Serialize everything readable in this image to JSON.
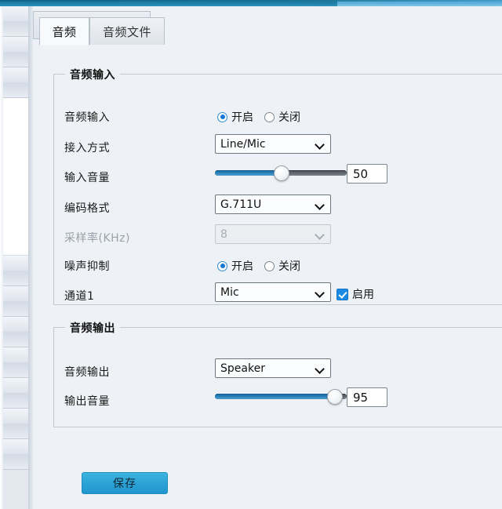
{
  "topstrip": {
    "color_left": "#1b7ba3",
    "color_right": "#5fb3dd"
  },
  "tabs": [
    {
      "label": "音频",
      "active": true
    },
    {
      "label": "音频文件",
      "active": false
    }
  ],
  "sections": {
    "audio_input": {
      "legend": "音频输入",
      "rows": {
        "audio_input": {
          "label": "音频输入",
          "on_label": "开启",
          "off_label": "关闭",
          "value": "开启"
        },
        "access_mode": {
          "label": "接入方式",
          "value": "Line/Mic"
        },
        "input_volume": {
          "label": "输入音量",
          "value": "50",
          "percent": 50
        },
        "encode_format": {
          "label": "编码格式",
          "value": "G.711U"
        },
        "sample_rate": {
          "label": "采样率(KHz)",
          "value": "8",
          "disabled": true
        },
        "noise_suppress": {
          "label": "噪声抑制",
          "on_label": "开启",
          "off_label": "关闭",
          "value": "开启"
        },
        "channel1": {
          "label": "通道1",
          "value": "Mic",
          "enable_label": "启用",
          "enabled": true
        }
      }
    },
    "audio_output": {
      "legend": "音频输出",
      "rows": {
        "audio_output": {
          "label": "音频输出",
          "value": "Speaker"
        },
        "output_volume": {
          "label": "输出音量",
          "value": "95",
          "percent": 95
        }
      }
    }
  },
  "footer": {
    "save_label": "保存"
  }
}
